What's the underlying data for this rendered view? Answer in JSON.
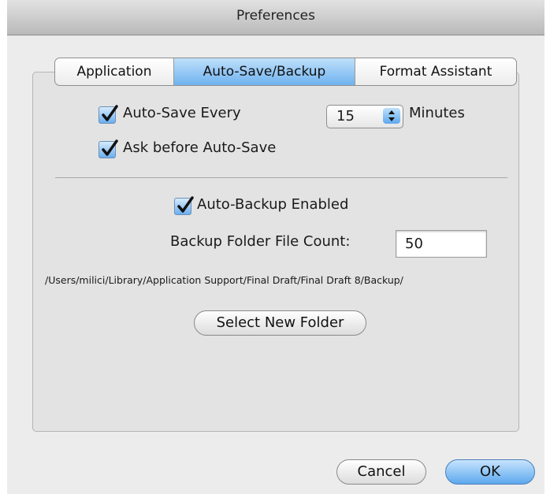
{
  "window": {
    "title": "Preferences"
  },
  "tabs": [
    {
      "label": "Application"
    },
    {
      "label": "Auto-Save/Backup"
    },
    {
      "label": "Format Assistant"
    }
  ],
  "auto_save": {
    "label": "Auto-Save Every",
    "checked": true,
    "interval_value": "15",
    "interval_unit": "Minutes"
  },
  "ask_before": {
    "label": "Ask before Auto-Save",
    "checked": true
  },
  "auto_backup": {
    "label": "Auto-Backup Enabled",
    "checked": true
  },
  "backup_count": {
    "label": "Backup Folder File Count:",
    "value": "50"
  },
  "backup_path": "/Users/milici/Library/Application Support/Final Draft/Final Draft 8/Backup/",
  "buttons": {
    "select_folder": "Select New Folder",
    "cancel": "Cancel",
    "ok": "OK"
  },
  "colors": {
    "accent": "#6fb2ef",
    "panel": "#e3e3e3",
    "window": "#ececec"
  }
}
